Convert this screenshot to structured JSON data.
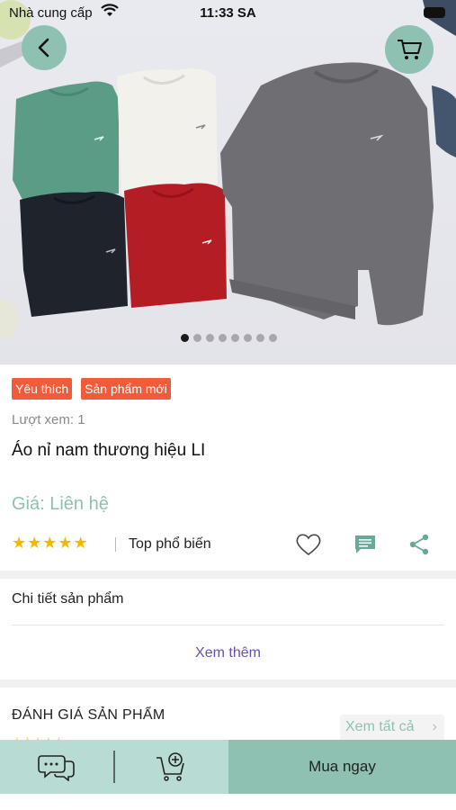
{
  "status_bar": {
    "carrier": "Nhà cung cấp",
    "time": "11:33 SA"
  },
  "gallery": {
    "image_count": 8,
    "active_index": 0
  },
  "badges": [
    "Yêu thích",
    "Sản phẩm mới"
  ],
  "product": {
    "views": "Lượt xem: 1",
    "name": "Áo nỉ nam thương hiệu LI",
    "price": "Giá: Liên hệ",
    "rating": 5,
    "stars": "★★★★★",
    "popular": "Top phổ biến"
  },
  "detail": {
    "title": "Chi tiết sản phẩm",
    "see_more": "Xem thêm"
  },
  "review": {
    "title": "ĐÁNH GIÁ SẢN PHẨM",
    "view_all": "Xem tất cả"
  },
  "bottom": {
    "buy_now": "Mua ngay"
  },
  "colors": {
    "accent": "#8fc1b2",
    "badge": "#f15a3b",
    "star": "#f5b800",
    "link": "#6a4fb3"
  }
}
